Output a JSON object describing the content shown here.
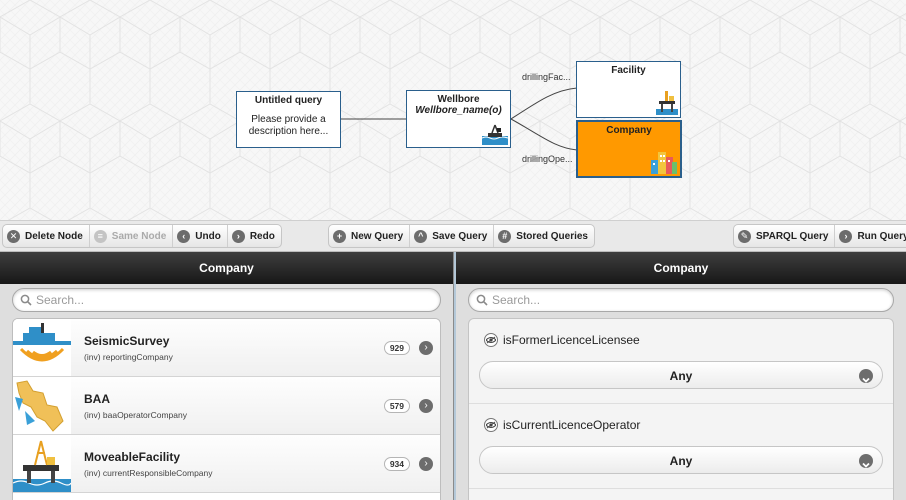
{
  "graph": {
    "nodes": [
      {
        "id": "untitled",
        "title": "Untitled query",
        "description": "Please provide a description here..."
      },
      {
        "id": "wellbore",
        "title": "Wellbore",
        "subtitle": "Wellbore_name(o)",
        "icon": "drilling-rig-sea-icon"
      },
      {
        "id": "facility",
        "title": "Facility",
        "icon": "oil-platform-icon"
      },
      {
        "id": "company",
        "title": "Company",
        "icon": "city-buildings-icon",
        "selected": true
      }
    ],
    "edges": [
      {
        "from": "wellbore",
        "to": "facility",
        "label": "drillingFac..."
      },
      {
        "from": "wellbore",
        "to": "company",
        "label": "drillingOpe..."
      }
    ],
    "selected_color": "#ff9900",
    "node_border_color": "#2a5f8c"
  },
  "toolbar": {
    "delete_node": "Delete Node",
    "same_node": "Same Node",
    "undo": "Undo",
    "redo": "Redo",
    "new_query": "New Query",
    "save_query": "Save Query",
    "stored_queries": "Stored Queries",
    "sparql_query": "SPARQL Query",
    "run_query": "Run Query"
  },
  "left_panel": {
    "title": "Company",
    "search_placeholder": "Search...",
    "items": [
      {
        "name": "SeismicSurvey",
        "relation": "(inv) reportingCompany",
        "count": "929",
        "icon": "seismic-vessel-icon"
      },
      {
        "name": "BAA",
        "relation": "(inv) baaOperatorCompany",
        "count": "579",
        "icon": "area-map-icon"
      },
      {
        "name": "MoveableFacility",
        "relation": "(inv) currentResponsibleCompany",
        "count": "934",
        "icon": "moveable-platform-icon"
      }
    ]
  },
  "right_panel": {
    "title": "Company",
    "search_placeholder": "Search...",
    "properties": [
      {
        "label": "isFormerLicenceLicensee",
        "value": "Any"
      },
      {
        "label": "isCurrentLicenceOperator",
        "value": "Any"
      }
    ]
  }
}
